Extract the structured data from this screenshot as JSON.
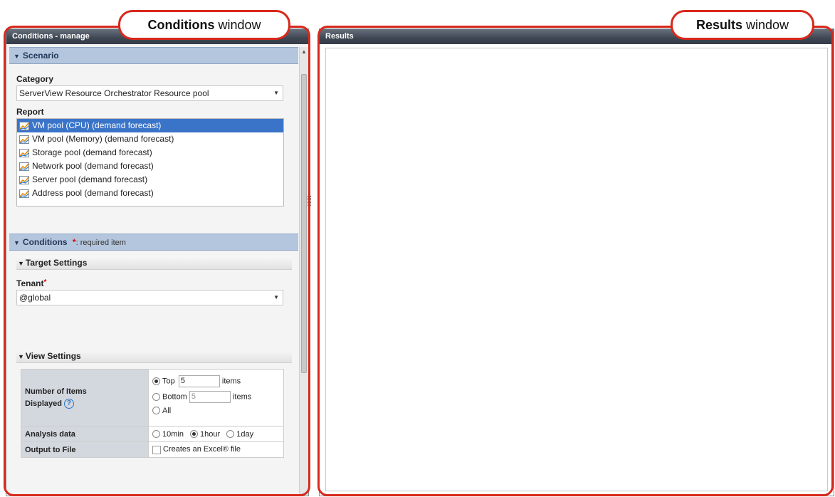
{
  "conditions_panel": {
    "title": "Conditions - manage",
    "scenario": {
      "header": "Scenario",
      "category_label": "Category",
      "category_value": "ServerView Resource Orchestrator Resource pool",
      "report_label": "Report",
      "reports": [
        "VM pool (CPU) (demand forecast)",
        "VM pool (Memory) (demand forecast)",
        "Storage pool (demand forecast)",
        "Network pool (demand forecast)",
        "Server pool (demand forecast)",
        "Address pool (demand forecast)"
      ],
      "selected_report_index": 0
    },
    "conditions": {
      "header": "Conditions",
      "required_star": "*",
      "required_note": ": required item",
      "target_settings": {
        "header": "Target Settings",
        "tenant_label": "Tenant",
        "tenant_value": "@global"
      },
      "view_settings": {
        "header": "View Settings",
        "number_of_items_label_1": "Number of Items",
        "number_of_items_label_2": "Displayed",
        "top_label": "Top",
        "top_value": "5",
        "top_suffix": "items",
        "bottom_label": "Bottom",
        "bottom_value": "5",
        "bottom_suffix": "items",
        "all_label": "All",
        "analysis_label": "Analysis data",
        "analysis_options": [
          "10min",
          "1hour",
          "1day"
        ],
        "analysis_selected": "1hour",
        "output_label": "Output to File",
        "output_checkbox_label": "Creates an Excel® file"
      }
    }
  },
  "results_panel": {
    "title": "Results"
  },
  "callouts": {
    "conditions_bold": "Conditions",
    "conditions_rest": " window",
    "results_bold": "Results",
    "results_rest": " window"
  },
  "colors": {
    "callout_red": "#d8281c",
    "header_dark": "#3e4652",
    "section_blue": "#b4c6dd",
    "selected_blue": "#3a74c9"
  }
}
